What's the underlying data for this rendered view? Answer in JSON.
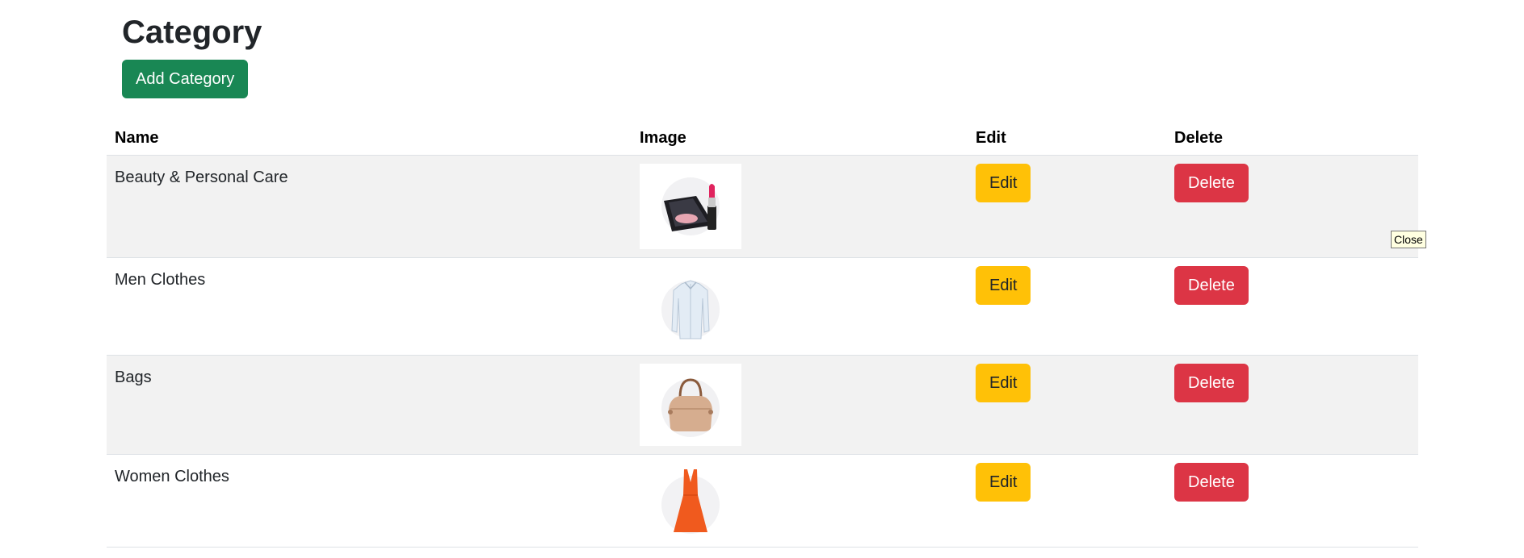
{
  "page": {
    "title": "Category",
    "add_button_label": "Add Category"
  },
  "table": {
    "headers": {
      "name": "Name",
      "image": "Image",
      "edit": "Edit",
      "delete": "Delete"
    },
    "rows": [
      {
        "name": "Beauty & Personal Care",
        "image_icon": "cosmetics-icon",
        "edit_label": "Edit",
        "delete_label": "Delete"
      },
      {
        "name": "Men Clothes",
        "image_icon": "shirt-icon",
        "edit_label": "Edit",
        "delete_label": "Delete"
      },
      {
        "name": "Bags",
        "image_icon": "handbag-icon",
        "edit_label": "Edit",
        "delete_label": "Delete"
      },
      {
        "name": "Women Clothes",
        "image_icon": "dress-icon",
        "edit_label": "Edit",
        "delete_label": "Delete"
      }
    ]
  },
  "tooltip": {
    "text": "Close"
  },
  "colors": {
    "add": "#198754",
    "edit": "#ffc107",
    "delete": "#dc3545",
    "stripe": "#f2f2f2"
  }
}
